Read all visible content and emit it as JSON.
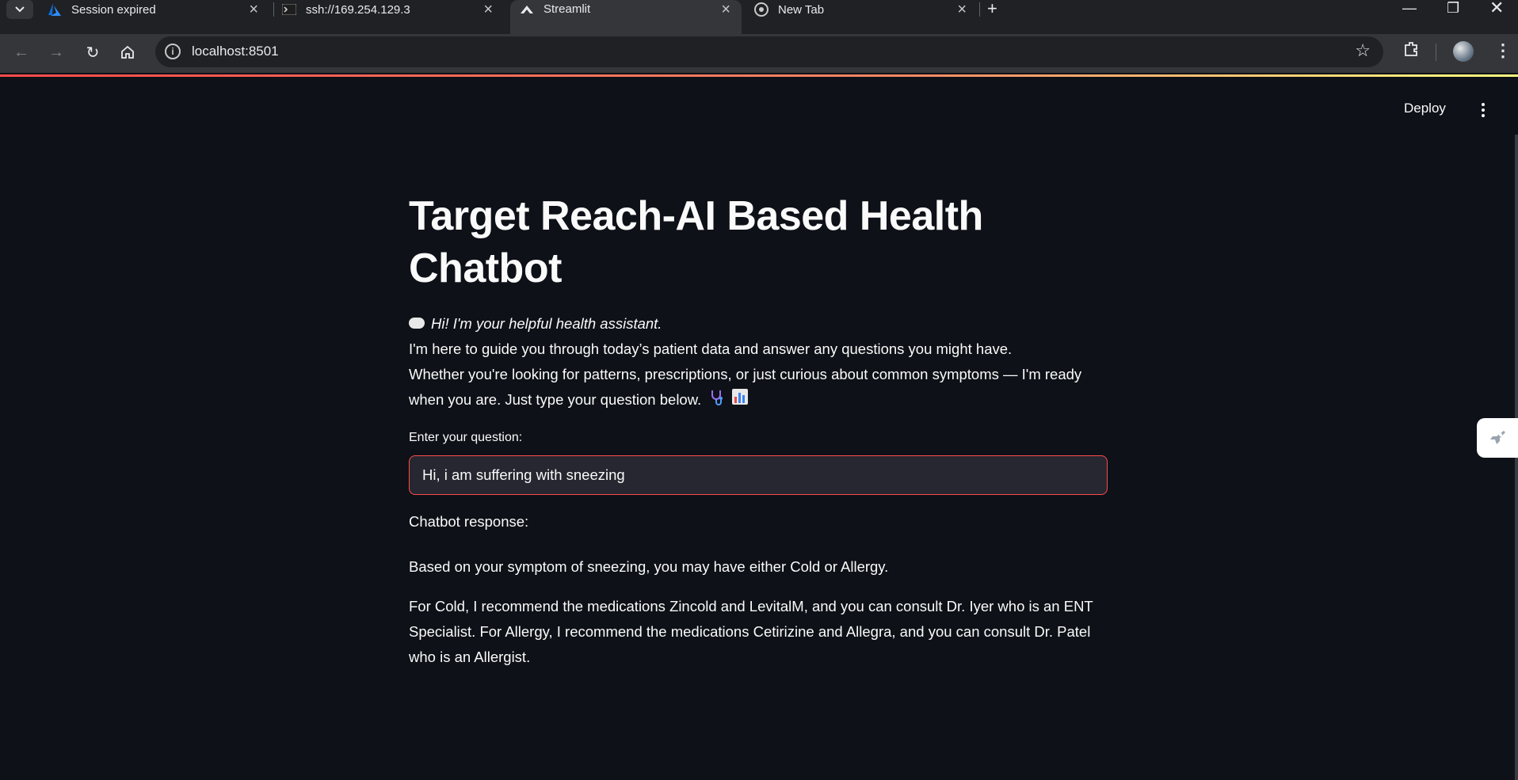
{
  "browser": {
    "tabs": [
      {
        "title": "Session expired",
        "icon": "azure-icon"
      },
      {
        "title": "ssh://169.254.129.3",
        "icon": "terminal-icon"
      },
      {
        "title": "Streamlit",
        "icon": "streamlit-icon",
        "active": true
      },
      {
        "title": "New Tab",
        "icon": "chrome-icon"
      }
    ],
    "url": "localhost:8501"
  },
  "app": {
    "deploy_label": "Deploy",
    "title": "Target Reach-AI Based Health Chatbot",
    "intro": {
      "lead": "Hi! I'm your helpful health assistant.",
      "line1": "I'm here to guide you through today’s patient data and answer any questions you might have.",
      "line2": "Whether you're looking for patterns, prescriptions, or just curious about common symptoms — I'm ready when you are. Just type your question below."
    },
    "question_label": "Enter your question:",
    "question_value": "Hi, i am suffering with sneezing",
    "response_label": "Chatbot response:",
    "response_paragraphs": [
      "Based on your symptom of sneezing, you may have either Cold or Allergy.",
      "For Cold, I recommend the medications Zincold and LevitalM, and you can consult Dr. Iyer who is an ENT Specialist. For Allergy, I recommend the medications Cetirizine and Allegra, and you can consult Dr. Patel who is an Allergist."
    ]
  },
  "colors": {
    "background": "#0e1117",
    "accent": "#ff4b4b",
    "input_bg": "#262730",
    "text": "#fafafa"
  }
}
